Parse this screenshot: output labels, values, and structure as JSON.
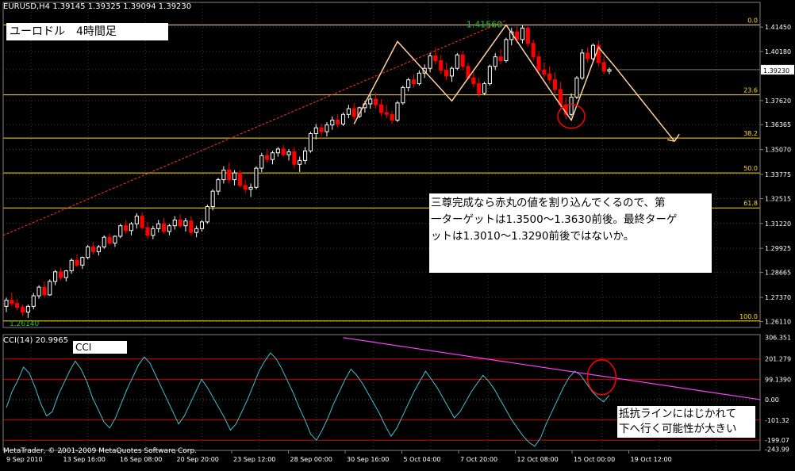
{
  "window": {
    "header": "EURUSD,H4  1.39145 1.39325 1.39094 1.39230",
    "title_box": "ユーロドル　4時間足",
    "copyright": "MetaTrader, © 2001-2009 MetaQuotes Software Corp."
  },
  "annotations": {
    "note1": [
      "三尊完成なら赤丸の値を割り込んでくるので、第",
      "一ターゲットは1.3500～1.3630前後。最終ターゲ",
      "ットは1.3010～1.3290前後ではないか。"
    ],
    "note2": [
      "抵抗ラインにはじかれて",
      "下へ行く可能性が大きい"
    ],
    "peak_label": "1.41560",
    "low_label": "1.26140"
  },
  "colors": {
    "background": "#000000",
    "grid": "#3c3c3c",
    "bull_candle": "#ffffff",
    "bear_candle": "#ff0000",
    "fib_line": "#ffe000",
    "pattern_line": "#ffd0a0",
    "trend_line": "#ff3030",
    "cci_line": "#40c0d0",
    "cci_level": "#d00000",
    "resistance_line": "#ff40ff",
    "circle": "#ff0000"
  },
  "chart_data": [
    {
      "type": "candlestick",
      "symbol": "EURUSD",
      "timeframe": "H4",
      "ohlc_last": {
        "open": 1.39145,
        "high": 1.39325,
        "low": 1.39094,
        "close": 1.3923
      },
      "y_ticks": [
        "1.41450",
        "1.40180",
        "1.39230",
        "1.37620",
        "1.36365",
        "1.35070",
        "1.33775",
        "1.32515",
        "1.31220",
        "1.29925",
        "1.28665",
        "1.27370",
        "1.26110"
      ],
      "ylim": [
        1.258,
        1.422
      ],
      "x_labels": [
        "9 Sep 2010",
        "13 Sep 16:00",
        "16 Sep 08:00",
        "20 Sep 20:00",
        "23 Sep 12:00",
        "28 Sep 00:00",
        "30 Sep 16:00",
        "5 Oct 04:00",
        "7 Oct 20:00",
        "12 Oct 08:00",
        "15 Oct 00:00",
        "19 Oct 12:00"
      ],
      "price_marker": 1.3923,
      "fibonacci": {
        "low": 1.2614,
        "high": 1.4156,
        "levels": [
          {
            "label": "0.0",
            "value": 1.4156
          },
          {
            "label": "23.6",
            "value": 1.37921
          },
          {
            "label": "38.2",
            "value": 1.3567
          },
          {
            "label": "50.0",
            "value": 1.3385
          },
          {
            "label": "61.8",
            "value": 1.3203
          },
          {
            "label": "100.0",
            "value": 1.2614
          }
        ]
      },
      "candles": [
        [
          1.269,
          1.2735,
          1.266,
          1.2722
        ],
        [
          1.2722,
          1.276,
          1.269,
          1.2705
        ],
        [
          1.2705,
          1.273,
          1.267,
          1.2685
        ],
        [
          1.2685,
          1.27,
          1.264,
          1.266
        ],
        [
          1.266,
          1.27,
          1.263,
          1.269
        ],
        [
          1.269,
          1.276,
          1.2675,
          1.2745
        ],
        [
          1.2745,
          1.28,
          1.273,
          1.279
        ],
        [
          1.279,
          1.282,
          1.274,
          1.275
        ],
        [
          1.275,
          1.283,
          1.2745,
          1.282
        ],
        [
          1.282,
          1.288,
          1.28,
          1.287
        ],
        [
          1.287,
          1.289,
          1.2825,
          1.284
        ],
        [
          1.284,
          1.288,
          1.282,
          1.2875
        ],
        [
          1.2875,
          1.294,
          1.286,
          1.293
        ],
        [
          1.293,
          1.296,
          1.2895,
          1.2905
        ],
        [
          1.2905,
          1.295,
          1.2885,
          1.2945
        ],
        [
          1.2945,
          1.301,
          1.2935,
          1.3
        ],
        [
          1.3,
          1.3025,
          1.296,
          1.2975
        ],
        [
          1.2975,
          1.301,
          1.2955,
          1.3
        ],
        [
          1.3,
          1.306,
          1.299,
          1.305
        ],
        [
          1.305,
          1.307,
          1.301,
          1.302
        ],
        [
          1.302,
          1.306,
          1.3,
          1.3055
        ],
        [
          1.3055,
          1.312,
          1.3045,
          1.311
        ],
        [
          1.311,
          1.314,
          1.307,
          1.3085
        ],
        [
          1.3085,
          1.313,
          1.306,
          1.312
        ],
        [
          1.312,
          1.3175,
          1.3095,
          1.316
        ],
        [
          1.316,
          1.318,
          1.309,
          1.31
        ],
        [
          1.31,
          1.313,
          1.304,
          1.306
        ],
        [
          1.306,
          1.311,
          1.304,
          1.3095
        ],
        [
          1.3095,
          1.314,
          1.3075,
          1.312
        ],
        [
          1.312,
          1.315,
          1.307,
          1.308
        ],
        [
          1.308,
          1.312,
          1.306,
          1.311
        ],
        [
          1.311,
          1.316,
          1.309,
          1.314
        ],
        [
          1.314,
          1.317,
          1.31,
          1.311
        ],
        [
          1.311,
          1.315,
          1.308,
          1.3135
        ],
        [
          1.3135,
          1.316,
          1.306,
          1.3075
        ],
        [
          1.3075,
          1.311,
          1.305,
          1.3095
        ],
        [
          1.3095,
          1.314,
          1.308,
          1.313
        ],
        [
          1.313,
          1.322,
          1.312,
          1.321
        ],
        [
          1.321,
          1.33,
          1.319,
          1.329
        ],
        [
          1.329,
          1.336,
          1.327,
          1.335
        ],
        [
          1.335,
          1.342,
          1.333,
          1.34
        ],
        [
          1.34,
          1.344,
          1.333,
          1.335
        ],
        [
          1.335,
          1.34,
          1.332,
          1.3385
        ],
        [
          1.3385,
          1.34,
          1.331,
          1.332
        ],
        [
          1.332,
          1.335,
          1.328,
          1.33
        ],
        [
          1.33,
          1.333,
          1.326,
          1.331
        ],
        [
          1.331,
          1.342,
          1.33,
          1.341
        ],
        [
          1.341,
          1.349,
          1.339,
          1.3475
        ],
        [
          1.3475,
          1.351,
          1.344,
          1.3455
        ],
        [
          1.3455,
          1.35,
          1.343,
          1.349
        ],
        [
          1.349,
          1.352,
          1.347,
          1.351
        ],
        [
          1.351,
          1.353,
          1.347,
          1.348
        ],
        [
          1.348,
          1.351,
          1.345,
          1.3495
        ],
        [
          1.3495,
          1.352,
          1.341,
          1.343
        ],
        [
          1.343,
          1.347,
          1.339,
          1.345
        ],
        [
          1.345,
          1.352,
          1.343,
          1.35
        ],
        [
          1.35,
          1.36,
          1.349,
          1.359
        ],
        [
          1.359,
          1.364,
          1.356,
          1.362
        ],
        [
          1.362,
          1.364,
          1.358,
          1.36
        ],
        [
          1.36,
          1.365,
          1.3575,
          1.3635
        ],
        [
          1.3635,
          1.368,
          1.361,
          1.366
        ],
        [
          1.366,
          1.369,
          1.362,
          1.364
        ],
        [
          1.364,
          1.37,
          1.363,
          1.369
        ],
        [
          1.369,
          1.374,
          1.367,
          1.372
        ],
        [
          1.372,
          1.375,
          1.366,
          1.368
        ],
        [
          1.368,
          1.373,
          1.367,
          1.3725
        ],
        [
          1.3725,
          1.376,
          1.37,
          1.3745
        ],
        [
          1.3745,
          1.379,
          1.372,
          1.377
        ],
        [
          1.377,
          1.38,
          1.372,
          1.374
        ],
        [
          1.374,
          1.377,
          1.368,
          1.37
        ],
        [
          1.37,
          1.374,
          1.367,
          1.369
        ],
        [
          1.369,
          1.371,
          1.364,
          1.366
        ],
        [
          1.366,
          1.376,
          1.365,
          1.375
        ],
        [
          1.375,
          1.384,
          1.374,
          1.383
        ],
        [
          1.383,
          1.388,
          1.381,
          1.387
        ],
        [
          1.387,
          1.39,
          1.383,
          1.385
        ],
        [
          1.385,
          1.392,
          1.384,
          1.3905
        ],
        [
          1.3905,
          1.395,
          1.388,
          1.393
        ],
        [
          1.393,
          1.401,
          1.391,
          1.3995
        ],
        [
          1.3995,
          1.404,
          1.395,
          1.397
        ],
        [
          1.397,
          1.4,
          1.39,
          1.392
        ],
        [
          1.392,
          1.396,
          1.387,
          1.389
        ],
        [
          1.389,
          1.394,
          1.386,
          1.393
        ],
        [
          1.393,
          1.401,
          1.392,
          1.4
        ],
        [
          1.4,
          1.402,
          1.392,
          1.394
        ],
        [
          1.394,
          1.396,
          1.387,
          1.388
        ],
        [
          1.388,
          1.391,
          1.383,
          1.385
        ],
        [
          1.385,
          1.388,
          1.378,
          1.38
        ],
        [
          1.38,
          1.386,
          1.379,
          1.385
        ],
        [
          1.385,
          1.395,
          1.384,
          1.394
        ],
        [
          1.394,
          1.401,
          1.392,
          1.399
        ],
        [
          1.399,
          1.403,
          1.395,
          1.397
        ],
        [
          1.397,
          1.409,
          1.396,
          1.408
        ],
        [
          1.408,
          1.414,
          1.405,
          1.412
        ],
        [
          1.412,
          1.415,
          1.406,
          1.408
        ],
        [
          1.408,
          1.4156,
          1.406,
          1.414
        ],
        [
          1.414,
          1.415,
          1.404,
          1.406
        ],
        [
          1.406,
          1.408,
          1.397,
          1.399
        ],
        [
          1.399,
          1.402,
          1.39,
          1.392
        ],
        [
          1.392,
          1.396,
          1.388,
          1.39
        ],
        [
          1.39,
          1.394,
          1.385,
          1.387
        ],
        [
          1.387,
          1.391,
          1.38,
          1.382
        ],
        [
          1.382,
          1.386,
          1.372,
          1.374
        ],
        [
          1.374,
          1.378,
          1.3665,
          1.369
        ],
        [
          1.369,
          1.38,
          1.368,
          1.378
        ],
        [
          1.378,
          1.389,
          1.377,
          1.388
        ],
        [
          1.388,
          1.403,
          1.387,
          1.401
        ],
        [
          1.401,
          1.404,
          1.396,
          1.398
        ],
        [
          1.398,
          1.406,
          1.397,
          1.405
        ],
        [
          1.405,
          1.4075,
          1.394,
          1.396
        ],
        [
          1.396,
          1.399,
          1.39,
          1.3915
        ],
        [
          1.3915,
          1.3935,
          1.39,
          1.3923
        ]
      ]
    },
    {
      "type": "line",
      "name": "CCI(14) 20.9965",
      "y_ticks": [
        "306.351",
        "201.279",
        "99.1390",
        "0.00",
        "-101.32",
        "-199.07",
        "-243.99"
      ],
      "ylim": [
        -250,
        320
      ],
      "levels": [
        200,
        100,
        0,
        -100,
        -200
      ],
      "values": [
        -40,
        40,
        95,
        160,
        130,
        60,
        -20,
        -80,
        -60,
        20,
        80,
        140,
        190,
        150,
        90,
        10,
        -50,
        -110,
        -140,
        -90,
        -20,
        50,
        110,
        170,
        210,
        180,
        120,
        60,
        0,
        -60,
        -120,
        -80,
        -20,
        40,
        100,
        60,
        10,
        -40,
        -90,
        -150,
        -120,
        -60,
        0,
        70,
        140,
        190,
        230,
        200,
        150,
        90,
        30,
        -40,
        -100,
        -170,
        -200,
        -150,
        -90,
        -20,
        40,
        100,
        150,
        120,
        80,
        30,
        -20,
        -70,
        -130,
        -180,
        -140,
        -80,
        -20,
        40,
        90,
        140,
        100,
        60,
        10,
        -40,
        -90,
        -60,
        -10,
        40,
        80,
        120,
        90,
        50,
        0,
        -50,
        -100,
        -140,
        -180,
        -210,
        -230,
        -190,
        -120,
        -60,
        0,
        60,
        110,
        140,
        120,
        80,
        40,
        10,
        -10,
        21
      ]
    }
  ]
}
